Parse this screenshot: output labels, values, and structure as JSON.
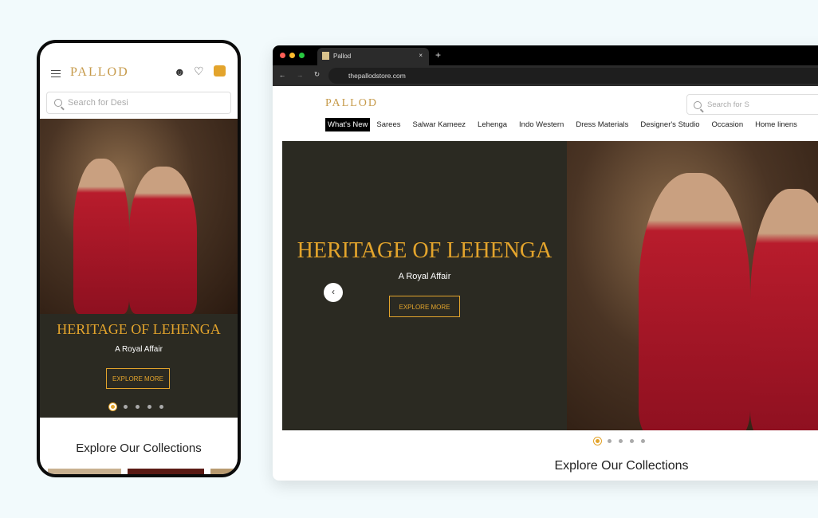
{
  "phone": {
    "logo": "PALLOD",
    "search_placeholder": "Search for Desi",
    "hero_title": "HERITAGE OF LEHENGA",
    "hero_subtitle": "A Royal Affair",
    "cta": "EXPLORE MORE",
    "section_title": "Explore Our Collections",
    "icons": [
      "menu-icon",
      "user-icon",
      "heart-icon",
      "shopping-bag-icon",
      "search-icon"
    ]
  },
  "browser": {
    "tab_title": "Pallod",
    "url": "thepallodstore.com",
    "logo": "PALLOD",
    "search_placeholder": "Search for S",
    "nav": [
      "What's New",
      "Sarees",
      "Salwar Kameez",
      "Lehenga",
      "Indo Western",
      "Dress Materials",
      "Designer's Studio",
      "Occasion",
      "Home linens"
    ],
    "hero_title": "HERITAGE OF LEHENGA",
    "hero_subtitle": "A Royal Affair",
    "cta": "EXPLORE MORE",
    "section_title": "Explore Our Collections",
    "active_slide": 1,
    "slides": 5
  },
  "colors": {
    "accent": "#e3a42c",
    "hero_bg": "#2b2a22"
  }
}
